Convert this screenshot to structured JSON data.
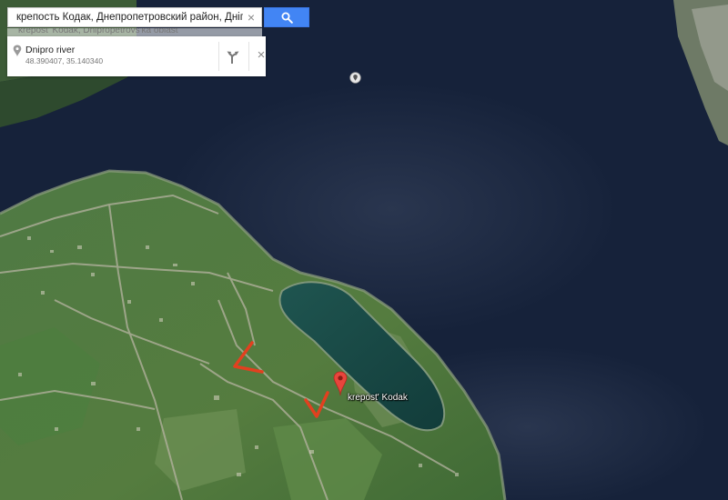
{
  "search": {
    "query": "крепость Кодак, Днепропетровский район, Днiпропет",
    "clear_symbol": "×",
    "suggestion_faint": "krepost' Kodak, Dnipropetrovs'ka oblast"
  },
  "card": {
    "title": "Dnipro river",
    "coords": "48.390407, 35.140340",
    "close_symbol": "×"
  },
  "map": {
    "place_label": "krepost' Kodak",
    "pin_color": "#e8453c",
    "annotation_color": "#e2401f",
    "water_color": "#16223a"
  },
  "icons": [
    "location-pin-icon",
    "directions-icon",
    "search-icon",
    "close-icon",
    "map-pin-icon",
    "poi-icon"
  ]
}
